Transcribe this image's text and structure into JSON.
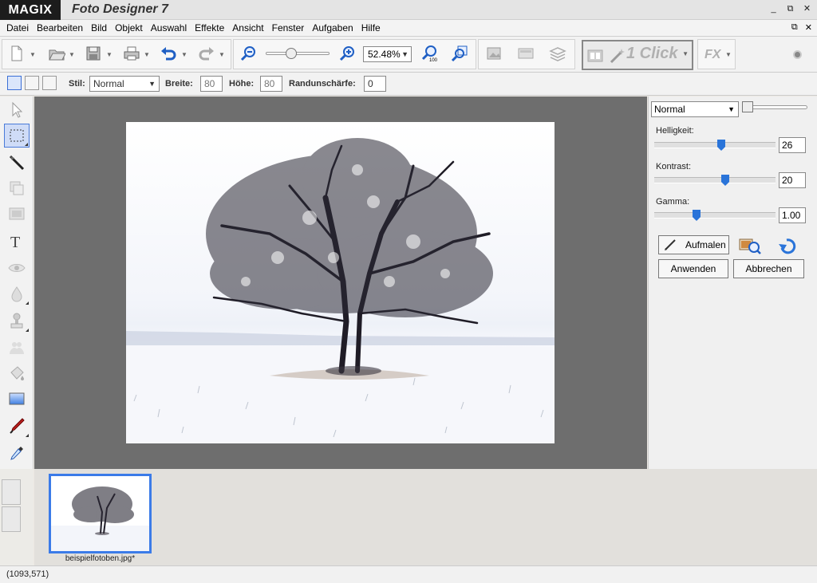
{
  "titlebar": {
    "logo": "MAGIX",
    "title": "Foto Designer 7",
    "minimize": "_",
    "restore": "⧉",
    "close": "✕"
  },
  "menu": {
    "items": [
      "Datei",
      "Bearbeiten",
      "Bild",
      "Objekt",
      "Auswahl",
      "Effekte",
      "Ansicht",
      "Fenster",
      "Aufgaben",
      "Hilfe"
    ],
    "mdi_restore": "⧉",
    "mdi_close": "✕"
  },
  "toolbar": {
    "zoom_value": "52.48%",
    "one_click_label": "1 Click"
  },
  "options": {
    "stil_label": "Stil:",
    "stil_value": "Normal",
    "breite_label": "Breite:",
    "breite_value": "80",
    "hoehe_label": "Höhe:",
    "hoehe_value": "80",
    "rand_label": "Randunschärfe:",
    "rand_value": "0"
  },
  "right_panel": {
    "blend_mode": "Normal",
    "helligkeit_label": "Helligkeit:",
    "helligkeit_value": "26",
    "kontrast_label": "Kontrast:",
    "kontrast_value": "20",
    "gamma_label": "Gamma:",
    "gamma_value": "1.00",
    "aufmalen_label": "Aufmalen",
    "anwenden_label": "Anwenden",
    "abbrechen_label": "Abbrechen"
  },
  "filmstrip": {
    "thumb_label": "beispielfotoben.jpg*"
  },
  "status": {
    "coords": "(1093,571)"
  },
  "colors": {
    "accent": "#3b7be8",
    "canvas_bg": "#6e6e6e",
    "slider_thumb": "#2a74d9"
  },
  "icons": [
    "new-file-icon",
    "open-folder-icon",
    "save-icon",
    "print-icon",
    "undo-icon",
    "redo-icon",
    "zoom-out-icon",
    "zoom-in-icon",
    "zoom-100-icon",
    "zoom-fit-icon",
    "arrow-icon",
    "marquee-icon",
    "brush-icon",
    "text-icon",
    "eye-icon",
    "drop-icon",
    "stamp-icon",
    "bucket-icon",
    "gradient-icon",
    "pen-icon",
    "eyedropper-icon"
  ]
}
